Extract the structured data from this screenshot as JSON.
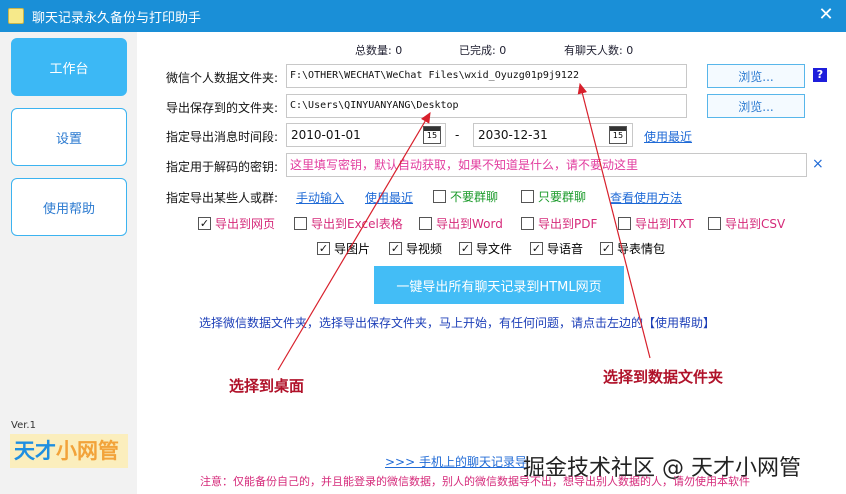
{
  "window": {
    "title": "聊天记录永久备份与打印助手",
    "close": "✕"
  },
  "sidebar": {
    "items": [
      {
        "label": "工作台",
        "active": true
      },
      {
        "label": "设置",
        "active": false
      },
      {
        "label": "使用帮助",
        "active": false
      }
    ],
    "version": "Ver.1",
    "logo_part1": "天才",
    "logo_part2": "小网管"
  },
  "stats": {
    "total": "总数量: 0",
    "done": "已完成: 0",
    "contacts": "有聊天人数: 0"
  },
  "fields": {
    "data_folder_label": "微信个人数据文件夹:",
    "data_folder_value": "F:\\OTHER\\WECHAT\\WeChat Files\\wxid_Oyuzg01p9j9122",
    "browse1": "浏览...",
    "help_q": "?",
    "save_folder_label": "导出保存到的文件夹:",
    "save_folder_value": "C:\\Users\\QINYUANYANG\\Desktop",
    "browse2": "浏览...",
    "range_label": "指定导出消息时间段:",
    "date_from": "2010-01-01",
    "date_to": "2030-12-31",
    "date_sep": "-",
    "cal_day": "15",
    "recent_link": "使用最近",
    "key_label": "指定用于解码的密钥:",
    "key_value": "这里填写密钥，默认自动获取，如果不知道是什么，请不要动这里",
    "key_clear": "×",
    "people_label": "指定导出某些人或群:",
    "manual_input": "手动输入",
    "use_recent": "使用最近",
    "no_group": "不要群聊",
    "only_group": "只要群聊",
    "view_usage": "查看使用方法"
  },
  "export_formats": [
    {
      "label": "导出到网页",
      "checked": true
    },
    {
      "label": "导出到Excel表格",
      "checked": false
    },
    {
      "label": "导出到Word",
      "checked": false
    },
    {
      "label": "导出到PDF",
      "checked": false
    },
    {
      "label": "导出到TXT",
      "checked": false
    },
    {
      "label": "导出到CSV",
      "checked": false
    }
  ],
  "media_options": [
    {
      "label": "导图片",
      "checked": true
    },
    {
      "label": "导视频",
      "checked": true
    },
    {
      "label": "导文件",
      "checked": true
    },
    {
      "label": "导语音",
      "checked": true
    },
    {
      "label": "导表情包",
      "checked": true
    }
  ],
  "colors": {
    "title_bar": "#1a8fd7",
    "accent": "#3cb8f5",
    "annotation": "#b0122a"
  },
  "main_button": "一键导出所有聊天记录到HTML网页",
  "hint": "选择微信数据文件夹，选择导出保存文件夹，马上开始，有任何问题，请点击左边的【使用帮助】",
  "annotations": {
    "desktop": "选择到桌面",
    "data_folder": "选择到数据文件夹"
  },
  "bottom_link": ">>>  手机上的聊天记录导",
  "watermark": "掘金技术社区 @ 天才小网管",
  "note": "注意：仅能备份自己的，并且能登录的微信数据，别人的微信数据导不出，想导出别人数据的人，请勿使用本软件"
}
